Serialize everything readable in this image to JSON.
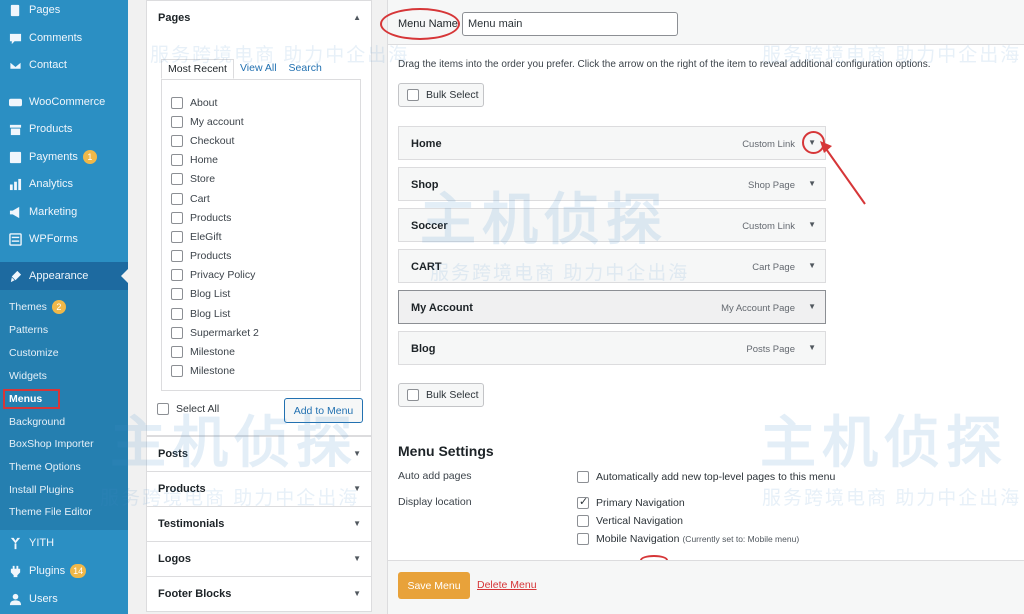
{
  "sidebar": {
    "items": [
      {
        "label": "Pages",
        "icon": "pages-icon"
      },
      {
        "label": "Comments",
        "icon": "comments-icon"
      },
      {
        "label": "Contact",
        "icon": "mail-icon"
      },
      {
        "label": "WooCommerce",
        "icon": "woo-icon"
      },
      {
        "label": "Products",
        "icon": "archive-icon"
      },
      {
        "label": "Payments",
        "icon": "dollar-icon",
        "badge": "1"
      },
      {
        "label": "Analytics",
        "icon": "chart-icon"
      },
      {
        "label": "Marketing",
        "icon": "megaphone-icon"
      },
      {
        "label": "WPForms",
        "icon": "form-icon"
      },
      {
        "label": "Appearance",
        "icon": "brush-icon"
      }
    ],
    "appearance_sub": [
      {
        "label": "Themes",
        "badge": "2"
      },
      {
        "label": "Patterns"
      },
      {
        "label": "Customize"
      },
      {
        "label": "Widgets"
      },
      {
        "label": "Menus"
      },
      {
        "label": "Background"
      },
      {
        "label": "BoxShop Importer"
      },
      {
        "label": "Theme Options"
      },
      {
        "label": "Install Plugins"
      },
      {
        "label": "Theme File Editor"
      }
    ],
    "bottom": [
      {
        "label": "YITH",
        "icon": "yith-icon"
      },
      {
        "label": "Plugins",
        "icon": "plugin-icon",
        "badge": "14"
      },
      {
        "label": "Users",
        "icon": "users-icon"
      }
    ]
  },
  "pages_panel": {
    "title": "Pages",
    "tabs": [
      "Most Recent",
      "View All",
      "Search"
    ],
    "items": [
      "About",
      "My account",
      "Checkout",
      "Home",
      "Store",
      "Cart",
      "Products",
      "EleGift",
      "Products",
      "Privacy Policy",
      "Blog List",
      "Blog List",
      "Supermarket 2",
      "Milestone",
      "Milestone"
    ],
    "select_all": "Select All",
    "add_button": "Add to Menu"
  },
  "accordions": [
    "Posts",
    "Products",
    "Testimonials",
    "Logos",
    "Footer Blocks"
  ],
  "menu": {
    "name_label": "Menu Name",
    "name_value": "Menu main",
    "instructions": "Drag the items into the order you prefer. Click the arrow on the right of the item to reveal additional configuration options.",
    "bulk_select": "Bulk Select",
    "items": [
      {
        "title": "Home",
        "type": "Custom Link"
      },
      {
        "title": "Shop",
        "type": "Shop Page"
      },
      {
        "title": "Soccer",
        "type": "Custom Link"
      },
      {
        "title": "CART",
        "type": "Cart Page"
      },
      {
        "title": "My Account",
        "type": "My Account Page"
      },
      {
        "title": "Blog",
        "type": "Posts Page"
      }
    ]
  },
  "settings": {
    "title": "Menu Settings",
    "auto_add_label": "Auto add pages",
    "auto_add_option": "Automatically add new top-level pages to this menu",
    "display_label": "Display location",
    "locations": [
      {
        "label": "Primary Navigation",
        "checked": true,
        "note": ""
      },
      {
        "label": "Vertical Navigation",
        "checked": false,
        "note": ""
      },
      {
        "label": "Mobile Navigation",
        "checked": false,
        "note": "(Currently set to: Mobile menu)"
      }
    ]
  },
  "footer": {
    "save": "Save Menu",
    "delete": "Delete Menu"
  },
  "watermark": {
    "tagline": "服务跨境电商 助力中企出海",
    "brand": "主机侦探"
  },
  "colors": {
    "sidebar": "#2b8fc3",
    "sidebar_active": "#1d6aa0",
    "annotation_red": "#d63638",
    "save_button": "#e8a23a",
    "link": "#2271b1"
  }
}
